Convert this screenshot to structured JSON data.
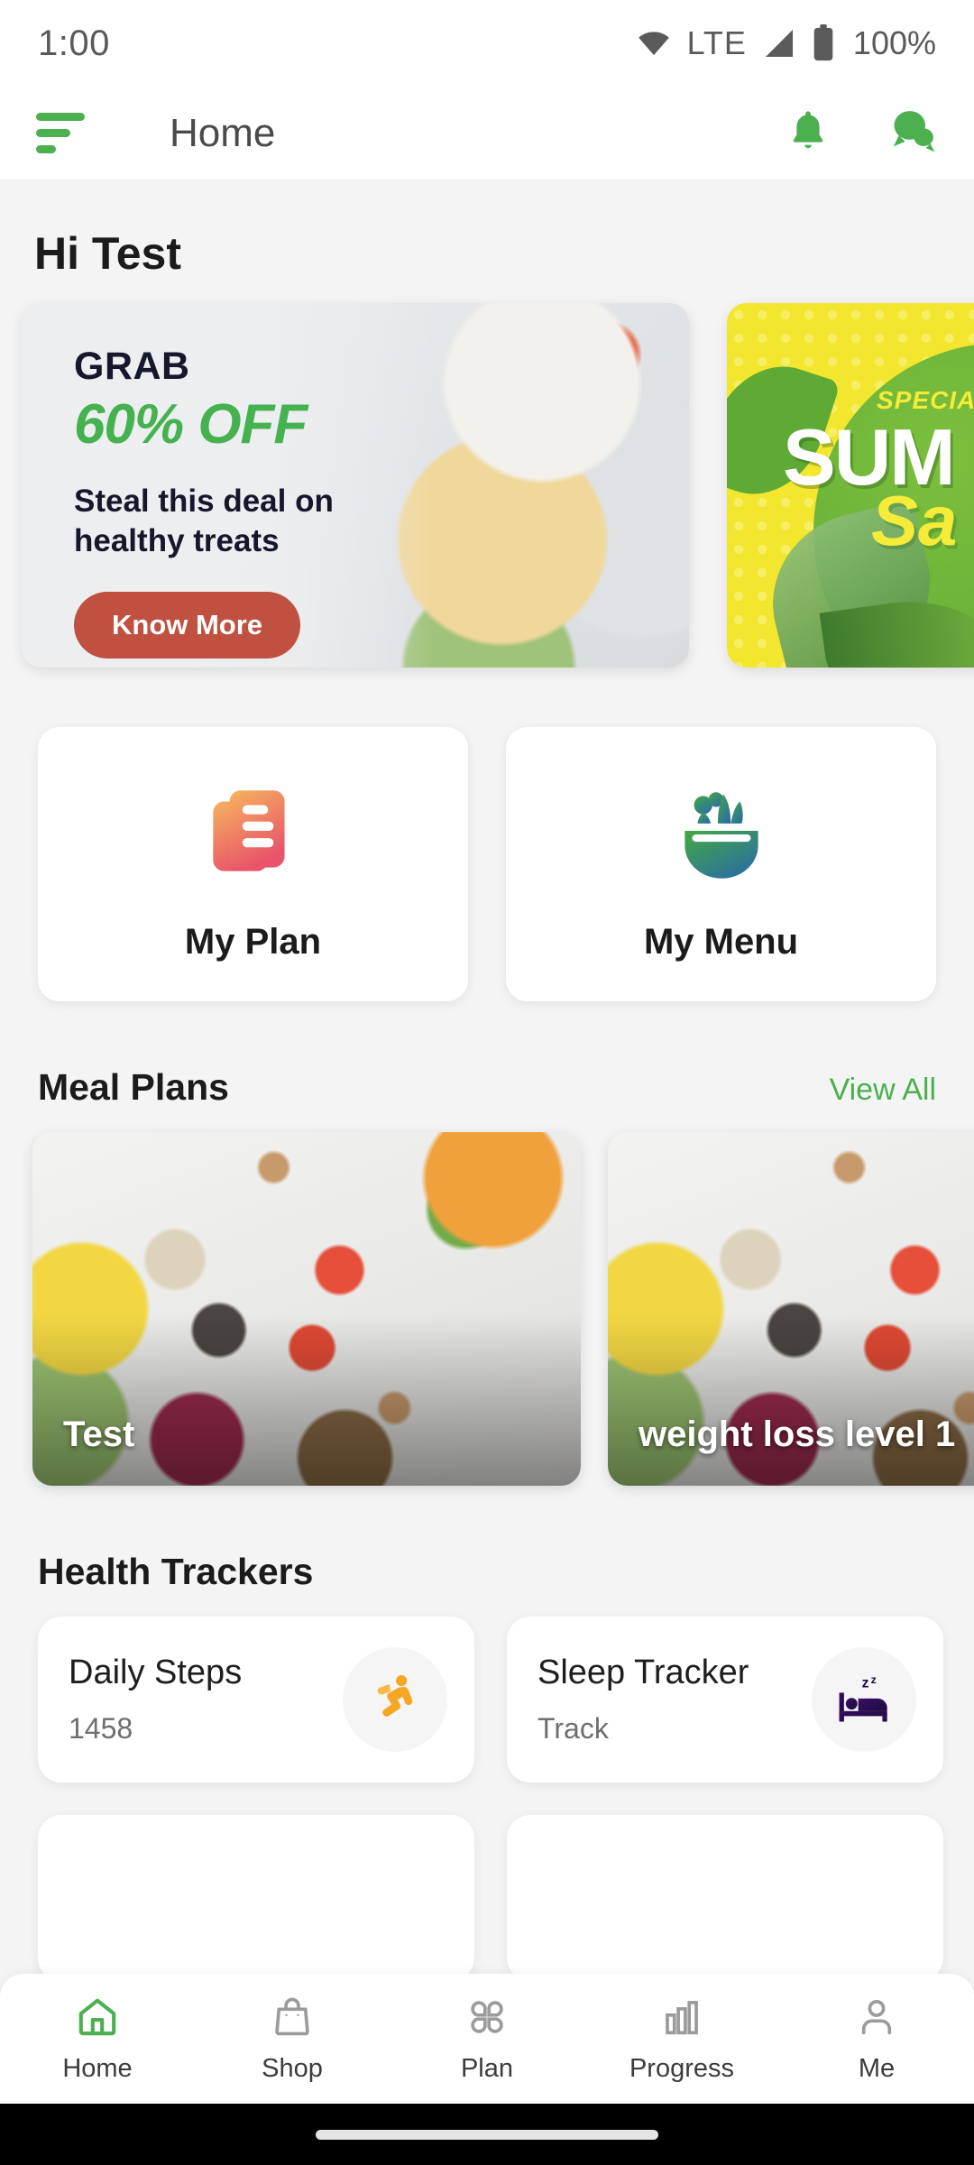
{
  "status_bar": {
    "time": "1:00",
    "network_label": "LTE",
    "battery_label": "100%",
    "wifi_icon": "wifi-icon",
    "signal_icon": "signal-icon",
    "battery_icon": "battery-icon"
  },
  "app_bar": {
    "menu_icon": "hamburger-menu-icon",
    "title": "Home",
    "notification_icon": "bell-icon",
    "chat_icon": "chat-bubbles-icon"
  },
  "greeting": "Hi Test",
  "promos": [
    {
      "eyebrow": "GRAB",
      "headline": "60% OFF",
      "subtext": "Steal this deal on\nhealthy treats",
      "subtext_line1": "Steal this deal on",
      "subtext_line2": "healthy treats",
      "cta_label": "Know More",
      "cta_color": "#c0503f",
      "headline_color": "#46b24f"
    },
    {
      "eyebrow": "SPECIAL",
      "headline": "SUM",
      "script": "Sa",
      "background_color": "#f2e62e",
      "blob_color": "#58a633"
    }
  ],
  "quick_tiles": [
    {
      "label": "My Plan",
      "icon": "document-stack-icon",
      "gradient_from": "#f6b25f",
      "gradient_to": "#e8556a"
    },
    {
      "label": "My Menu",
      "icon": "salad-bowl-icon",
      "gradient_from": "#43a843",
      "gradient_to": "#2a6ea3"
    }
  ],
  "meal_plans": {
    "section_title": "Meal Plans",
    "view_all_label": "View All",
    "view_all_color": "#4caf50",
    "cards": [
      {
        "title": "Test"
      },
      {
        "title": "weight loss level 1"
      }
    ]
  },
  "health_trackers": {
    "section_title": "Health Trackers",
    "cards": [
      {
        "name": "Daily Steps",
        "value": "1458",
        "icon": "running-person-icon",
        "icon_color": "#f5a623"
      },
      {
        "name": "Sleep Tracker",
        "value": "Track",
        "icon": "bed-sleep-icon",
        "icon_color": "#3a0f64"
      }
    ]
  },
  "bottom_nav": {
    "active_color": "#4caf50",
    "inactive_color": "#9b9b9b",
    "items": [
      {
        "label": "Home",
        "icon": "home-icon",
        "active": true
      },
      {
        "label": "Shop",
        "icon": "shopping-bag-icon",
        "active": false
      },
      {
        "label": "Plan",
        "icon": "grid-clover-icon",
        "active": false
      },
      {
        "label": "Progress",
        "icon": "bar-chart-icon",
        "active": false
      },
      {
        "label": "Me",
        "icon": "person-icon",
        "active": false
      }
    ]
  }
}
